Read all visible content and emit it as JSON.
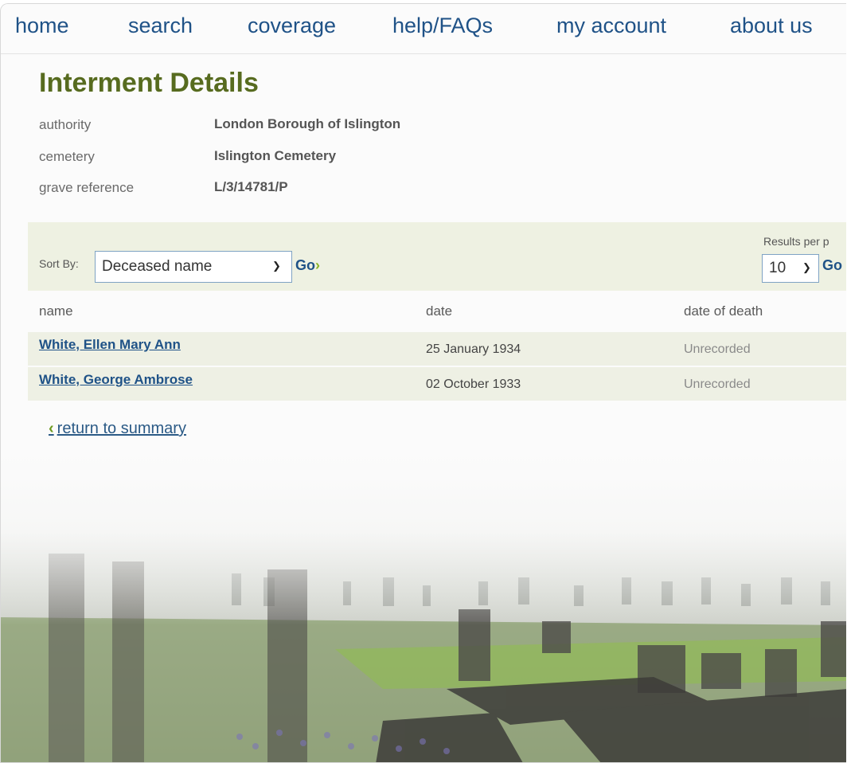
{
  "nav": {
    "items": [
      "home",
      "search",
      "coverage",
      "help/FAQs",
      "my account",
      "about us"
    ]
  },
  "page": {
    "title": "Interment Details"
  },
  "details": {
    "authority_label": "authority",
    "authority_value": "London Borough of Islington",
    "cemetery_label": "cemetery",
    "cemetery_value": "Islington Cemetery",
    "grave_label": "grave reference",
    "grave_value": "L/3/14781/P"
  },
  "sort": {
    "label": "Sort By:",
    "selected": "Deceased name",
    "go_label": "Go"
  },
  "results_per_page": {
    "label": "Results per p",
    "selected": "10",
    "go_label": "Go"
  },
  "table": {
    "headers": [
      "name",
      "date",
      "date of death"
    ],
    "rows": [
      {
        "name": "White, Ellen Mary Ann",
        "date": "25 January 1934",
        "date_of_death": "Unrecorded"
      },
      {
        "name": "White, George Ambrose",
        "date": "02 October 1933",
        "date_of_death": "Unrecorded"
      }
    ]
  },
  "return_link": "return to summary",
  "colors": {
    "title_green": "#576b1f",
    "link_blue": "#1f5287",
    "band_bg": "#eef1e2",
    "arrow_green": "#8cb526"
  }
}
